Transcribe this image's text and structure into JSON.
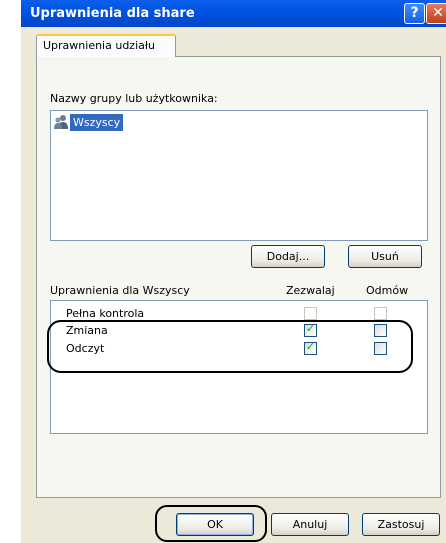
{
  "window": {
    "title": "Uprawnienia dla share",
    "help_glyph": "?",
    "close_glyph": "✕"
  },
  "tab": {
    "label": "Uprawnienia udziału"
  },
  "groups": {
    "label": "Nazwy grupy lub użytkownika:",
    "items": [
      {
        "name": "Wszyscy",
        "selected": true
      }
    ]
  },
  "buttons": {
    "add": "Dodaj...",
    "remove": "Usuń",
    "ok": "OK",
    "cancel": "Anuluj",
    "apply": "Zastosuj"
  },
  "permissions": {
    "label": "Uprawnienia dla Wszyscy",
    "col_allow": "Zezwalaj",
    "col_deny": "Odmów",
    "rows": [
      {
        "name": "Pełna kontrola",
        "allow": false,
        "deny": false,
        "enabled": false
      },
      {
        "name": "Zmiana",
        "allow": true,
        "deny": false,
        "enabled": true
      },
      {
        "name": "Odczyt",
        "allow": true,
        "deny": false,
        "enabled": true
      }
    ]
  },
  "colors": {
    "title_bar": "#0054E3",
    "selection": "#316AC5",
    "check": "#21A121",
    "dialog_bg": "#ECE9D8"
  }
}
